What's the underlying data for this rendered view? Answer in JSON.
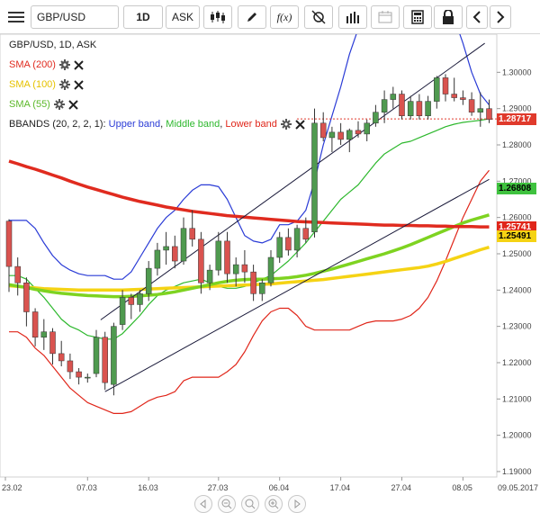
{
  "toolbar": {
    "symbol": "GBP/USD",
    "interval": "1D",
    "price_type": "ASK",
    "fx_label": "f(x)"
  },
  "legend": {
    "title": "GBP/USD, 1D, ASK",
    "sma200": "SMA (200)",
    "sma100": "SMA (100)",
    "sma55": "SMA (55)",
    "bbands_prefix": "BBANDS (20, 2, 2, 1): ",
    "upper": "Upper band",
    "middle": "Middle band",
    "lower": "Lower band",
    "sep": ", "
  },
  "colors": {
    "sma200": "#e02b1f",
    "sma100": "#f5d314",
    "sma55": "#7ed321",
    "upper": "#2a3bd6",
    "middle": "#2db82d",
    "lower": "#e0261a",
    "bull": "#4f9a4f",
    "bear": "#d9534f"
  },
  "price_tags": [
    {
      "text": "1.28717",
      "bg": "#e03a2c",
      "fg": "#fff"
    },
    {
      "text": "1.26808",
      "bg": "#3fc23f",
      "fg": "#000"
    },
    {
      "text": "1.25741",
      "bg": "#e0261a",
      "fg": "#fff"
    },
    {
      "text": "1.25491",
      "bg": "#f5d314",
      "fg": "#000"
    }
  ],
  "chart_data": {
    "type": "candlestick",
    "y_ticks": [
      "1.30000",
      "1.29000",
      "1.28000",
      "1.27000",
      "1.26000",
      "1.25000",
      "1.24000",
      "1.23000",
      "1.22000",
      "1.21000",
      "1.20000",
      "1.19000"
    ],
    "x_ticks": [
      "23.02",
      "07.03",
      "16.03",
      "27.03",
      "06.04",
      "17.04",
      "27.04",
      "08.05"
    ],
    "last_date": "09.05.2017",
    "ylim": [
      1.1885,
      1.3105
    ],
    "candles": [
      [
        1.259,
        1.2595,
        1.2395,
        1.2465
      ],
      [
        1.2465,
        1.249,
        1.2385,
        1.242
      ],
      [
        1.242,
        1.2435,
        1.23,
        1.234
      ],
      [
        1.234,
        1.235,
        1.2245,
        1.227
      ],
      [
        1.227,
        1.232,
        1.2235,
        1.2285
      ],
      [
        1.2285,
        1.2295,
        1.2195,
        1.2225
      ],
      [
        1.2225,
        1.226,
        1.219,
        1.2205
      ],
      [
        1.2205,
        1.2225,
        1.2155,
        1.2175
      ],
      [
        1.2175,
        1.2185,
        1.214,
        1.216
      ],
      [
        1.216,
        1.217,
        1.2145,
        1.216
      ],
      [
        1.217,
        1.229,
        1.216,
        1.227
      ],
      [
        1.227,
        1.2285,
        1.2125,
        1.2145
      ],
      [
        1.214,
        1.231,
        1.211,
        1.23
      ],
      [
        1.2305,
        1.24,
        1.229,
        1.238
      ],
      [
        1.238,
        1.239,
        1.232,
        1.236
      ],
      [
        1.236,
        1.24,
        1.234,
        1.239
      ],
      [
        1.239,
        1.248,
        1.237,
        1.246
      ],
      [
        1.246,
        1.253,
        1.244,
        1.251
      ],
      [
        1.251,
        1.256,
        1.247,
        1.252
      ],
      [
        1.252,
        1.255,
        1.246,
        1.248
      ],
      [
        1.248,
        1.26,
        1.247,
        1.257
      ],
      [
        1.257,
        1.262,
        1.252,
        1.254
      ],
      [
        1.254,
        1.256,
        1.239,
        1.242
      ],
      [
        1.242,
        1.247,
        1.24,
        1.2455
      ],
      [
        1.2455,
        1.256,
        1.244,
        1.2535
      ],
      [
        1.2535,
        1.256,
        1.242,
        1.2445
      ],
      [
        1.2445,
        1.249,
        1.241,
        1.247
      ],
      [
        1.247,
        1.251,
        1.242,
        1.245
      ],
      [
        1.245,
        1.247,
        1.237,
        1.239
      ],
      [
        1.239,
        1.243,
        1.237,
        1.242
      ],
      [
        1.242,
        1.251,
        1.241,
        1.249
      ],
      [
        1.249,
        1.256,
        1.2475,
        1.2545
      ],
      [
        1.2545,
        1.257,
        1.2495,
        1.251
      ],
      [
        1.251,
        1.258,
        1.249,
        1.257
      ],
      [
        1.257,
        1.26,
        1.253,
        1.254
      ],
      [
        1.256,
        1.29,
        1.2545,
        1.286
      ],
      [
        1.286,
        1.289,
        1.281,
        1.282
      ],
      [
        1.282,
        1.285,
        1.278,
        1.2835
      ],
      [
        1.2835,
        1.286,
        1.28,
        1.2815
      ],
      [
        1.2815,
        1.2845,
        1.278,
        1.284
      ],
      [
        1.284,
        1.2865,
        1.282,
        1.283
      ],
      [
        1.283,
        1.287,
        1.281,
        1.286
      ],
      [
        1.286,
        1.291,
        1.285,
        1.289
      ],
      [
        1.289,
        1.295,
        1.286,
        1.2925
      ],
      [
        1.2925,
        1.296,
        1.29,
        1.294
      ],
      [
        1.294,
        1.295,
        1.287,
        1.288
      ],
      [
        1.288,
        1.2935,
        1.287,
        1.292
      ],
      [
        1.292,
        1.294,
        1.287,
        1.288
      ],
      [
        1.288,
        1.2935,
        1.287,
        1.292
      ],
      [
        1.292,
        1.299,
        1.29,
        1.2985
      ],
      [
        1.2985,
        1.2995,
        1.292,
        1.294
      ],
      [
        1.294,
        1.2985,
        1.292,
        1.293
      ],
      [
        1.293,
        1.295,
        1.291,
        1.2925
      ],
      [
        1.2925,
        1.2945,
        1.288,
        1.289
      ],
      [
        1.289,
        1.2945,
        1.285,
        1.29
      ],
      [
        1.29,
        1.2925,
        1.286,
        1.287
      ]
    ],
    "sma200": [
      1.2755,
      1.2748,
      1.274,
      1.2733,
      1.2725,
      1.2717,
      1.2709,
      1.27,
      1.2692,
      1.2684,
      1.2677,
      1.267,
      1.2663,
      1.2656,
      1.265,
      1.2644,
      1.2639,
      1.2634,
      1.2629,
      1.2625,
      1.2621,
      1.2617,
      1.2614,
      1.2611,
      1.2608,
      1.2605,
      1.2603,
      1.2601,
      1.2599,
      1.2597,
      1.2595,
      1.2593,
      1.2591,
      1.2589,
      1.2588,
      1.2587,
      1.2586,
      1.2585,
      1.2584,
      1.2583,
      1.2582,
      1.2581,
      1.258,
      1.2579,
      1.2579,
      1.2578,
      1.2578,
      1.2577,
      1.2577,
      1.2576,
      1.2576,
      1.2575,
      1.2575,
      1.2575,
      1.2574,
      1.2574
    ],
    "sma100": [
      1.2412,
      1.241,
      1.2408,
      1.2406,
      1.2404,
      1.2403,
      1.2402,
      1.2401,
      1.24,
      1.24,
      1.24,
      1.24,
      1.24,
      1.24,
      1.2401,
      1.2402,
      1.2403,
      1.2404,
      1.2405,
      1.2406,
      1.2407,
      1.2408,
      1.2409,
      1.241,
      1.2411,
      1.2412,
      1.2413,
      1.2414,
      1.2415,
      1.2416,
      1.2417,
      1.2419,
      1.2421,
      1.2423,
      1.2425,
      1.2427,
      1.2429,
      1.2432,
      1.2435,
      1.2438,
      1.2441,
      1.2444,
      1.2447,
      1.245,
      1.2453,
      1.2456,
      1.2459,
      1.2462,
      1.2466,
      1.2472,
      1.2479,
      1.2487,
      1.2495,
      1.2503,
      1.2511,
      1.2518
    ],
    "sma55": [
      1.2415,
      1.2411,
      1.2407,
      1.2402,
      1.2398,
      1.2394,
      1.2391,
      1.2389,
      1.2387,
      1.2385,
      1.2384,
      1.2383,
      1.2382,
      1.2382,
      1.2383,
      1.2384,
      1.2386,
      1.2388,
      1.2391,
      1.2395,
      1.24,
      1.2405,
      1.241,
      1.2415,
      1.242,
      1.2424,
      1.2427,
      1.2429,
      1.243,
      1.243,
      1.2431,
      1.2432,
      1.2434,
      1.2437,
      1.2441,
      1.2446,
      1.2452,
      1.2458,
      1.2465,
      1.2472,
      1.2479,
      1.2486,
      1.2493,
      1.25,
      1.2508,
      1.2516,
      1.2525,
      1.2535,
      1.2545,
      1.2555,
      1.2565,
      1.2575,
      1.2585,
      1.2593,
      1.26,
      1.2607
    ],
    "bb_upper": [
      1.2592,
      1.2592,
      1.2592,
      1.257,
      1.253,
      1.2495,
      1.247,
      1.2455,
      1.2445,
      1.244,
      1.244,
      1.244,
      1.243,
      1.243,
      1.245,
      1.249,
      1.253,
      1.257,
      1.26,
      1.262,
      1.265,
      1.2675,
      1.269,
      1.269,
      1.2685,
      1.265,
      1.26,
      1.255,
      1.2535,
      1.253,
      1.254,
      1.258,
      1.258,
      1.259,
      1.262,
      1.27,
      1.28,
      1.288,
      1.296,
      1.305,
      1.312,
      1.316,
      1.318,
      1.32,
      1.322,
      1.3235,
      1.324,
      1.324,
      1.323,
      1.322,
      1.32,
      1.315,
      1.308,
      1.3,
      1.294,
      1.291
    ],
    "bb_middle": [
      1.244,
      1.244,
      1.243,
      1.2405,
      1.238,
      1.235,
      1.232,
      1.23,
      1.229,
      1.2275,
      1.227,
      1.2265,
      1.2265,
      1.228,
      1.2305,
      1.233,
      1.236,
      1.2385,
      1.24,
      1.241,
      1.242,
      1.2425,
      1.243,
      1.242,
      1.241,
      1.2405,
      1.2405,
      1.241,
      1.242,
      1.243,
      1.244,
      1.246,
      1.248,
      1.2505,
      1.253,
      1.256,
      1.259,
      1.262,
      1.265,
      1.267,
      1.269,
      1.272,
      1.275,
      1.2775,
      1.279,
      1.2805,
      1.281,
      1.282,
      1.283,
      1.284,
      1.285,
      1.2857,
      1.2862,
      1.2865,
      1.2868,
      1.2872
    ],
    "bb_lower": [
      1.2285,
      1.2285,
      1.227,
      1.224,
      1.222,
      1.219,
      1.216,
      1.213,
      1.211,
      1.209,
      1.208,
      1.207,
      1.206,
      1.206,
      1.2065,
      1.208,
      1.2095,
      1.2105,
      1.211,
      1.212,
      1.215,
      1.216,
      1.216,
      1.216,
      1.216,
      1.2175,
      1.2195,
      1.223,
      1.2275,
      1.2315,
      1.234,
      1.235,
      1.235,
      1.233,
      1.23,
      1.229,
      1.229,
      1.229,
      1.229,
      1.229,
      1.23,
      1.231,
      1.2315,
      1.2315,
      1.2315,
      1.232,
      1.233,
      1.235,
      1.238,
      1.2425,
      1.248,
      1.254,
      1.26,
      1.265,
      1.27,
      1.273
    ],
    "trendlines": [
      {
        "x1": 10.5,
        "y1": 1.2318,
        "x2": 54.5,
        "y2": 1.308
      },
      {
        "x1": 11.0,
        "y1": 1.212,
        "x2": 55.0,
        "y2": 1.2705
      }
    ],
    "current_price": 1.28717
  }
}
